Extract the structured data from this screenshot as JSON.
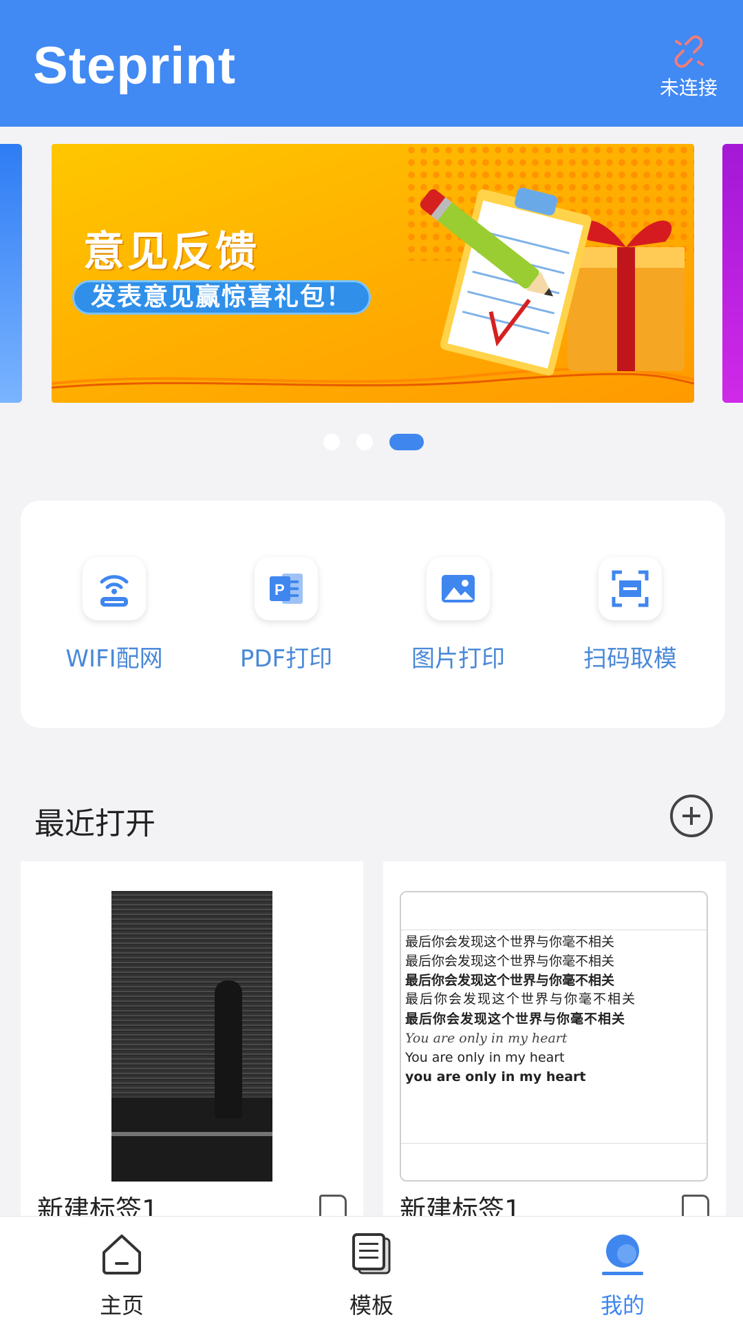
{
  "header": {
    "logo": "Steprint",
    "connection_label": "未连接"
  },
  "banner": {
    "title": "意见反馈",
    "subtitle": "发表意见赢惊喜礼包！",
    "page_count": 3,
    "active_index": 2
  },
  "actions": [
    {
      "label": "WIFI配网",
      "icon": "wifi-printer-icon"
    },
    {
      "label": "PDF打印",
      "icon": "pdf-icon"
    },
    {
      "label": "图片打印",
      "icon": "image-icon"
    },
    {
      "label": "扫码取模",
      "icon": "scan-icon"
    }
  ],
  "recent": {
    "title": "最近打开",
    "items": [
      {
        "name": "新建标签1",
        "thumbnail": "photo"
      },
      {
        "name": "新建标签1",
        "thumbnail": "text-label",
        "lines": [
          "最后你会发现这个世界与你毫不相关",
          "最后你会发现这个世界与你毫不相关",
          "最后你会发现这个世界与你毫不相关",
          "最后你会发现这个世界与你毫不相关",
          "最后你会发现这个世界与你毫不相关",
          "You are only in my heart",
          "You are only in my heart",
          "you are only in my heart"
        ]
      }
    ]
  },
  "tabbar": {
    "tabs": [
      {
        "label": "主页",
        "icon": "home-icon"
      },
      {
        "label": "模板",
        "icon": "template-icon"
      },
      {
        "label": "我的",
        "icon": "profile-icon"
      }
    ],
    "active_index": 2
  },
  "colors": {
    "brand": "#4189f3",
    "action_text": "#4a88d8",
    "disconnected": "#f07d7a"
  }
}
